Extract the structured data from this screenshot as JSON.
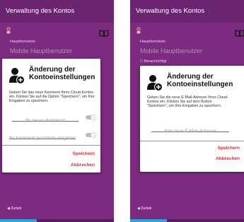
{
  "colors": {
    "app_background": "#7c2b80",
    "app_bar": "#6b2470",
    "dialog_background": "#ffffff",
    "action_red": "#d32f2f",
    "divider_red": "#e57373",
    "bottom_accent": "#33a0d8"
  },
  "screens": [
    {
      "app_title": "Verwaltung des Kontos",
      "background": {
        "user_label": "Hauptbenutzer",
        "user_value": "Mobile Hauptbenutzer",
        "row_label": "",
        "back_label": "Zurück"
      },
      "dialog": {
        "icon": "user-add-icon",
        "title_line1": "Änderung der",
        "title_line2": "Kontoeinstellungen",
        "body": "Geben Sie das neue Kennwort Ihres Cloud-Kontos ein. Klicken Sie auf die Option \"Speichern\", um Ihre Eingaben zu speichern.",
        "fields": [
          {
            "placeholder": "Ihr neues Kennwort",
            "value": ""
          },
          {
            "placeholder": "Ihr Kennwort nochmals eingeben",
            "value": ""
          }
        ],
        "save_label": "Speichern",
        "cancel_label": "Abbrechen"
      }
    },
    {
      "app_title": "Verwaltung des Kontos",
      "background": {
        "user_label": "Hauptbenutzer",
        "user_value": "Mobile Hauptbenutzer",
        "row_label": "Benachrichtigt",
        "back_label": "Zurück"
      },
      "dialog": {
        "icon": "user-add-icon",
        "title_line1": "Änderung der",
        "title_line2": "Kontoeinstellungen",
        "body": "Geben Sie die neue E-Mail-Adresse Ihres Cloud-Kontos ein. Klicken Sie auf dem Button \"Speichern\", um Ihre Eingaben zu speichern.",
        "fields": [
          {
            "placeholder": "Ihre neue E-Mail-Adresse",
            "value": ""
          }
        ],
        "save_label": "Speichern",
        "cancel_label": "Abbrechen"
      }
    }
  ]
}
